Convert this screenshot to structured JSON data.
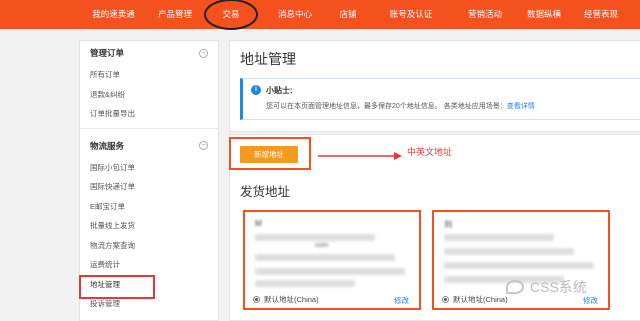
{
  "topnav": {
    "items": [
      "我的速卖通",
      "产品管理",
      "交易",
      "消息中心",
      "店铺",
      "账号及认证",
      "营销活动",
      "数据纵横",
      "经营表现"
    ],
    "active_index": 2
  },
  "sidebar": {
    "groups": [
      {
        "title": "管理订单",
        "toggle": "−",
        "items": [
          "所有订单",
          "退款&纠纷",
          "订单批量导出"
        ]
      },
      {
        "title": "物流服务",
        "toggle": "−",
        "items": [
          "国际小包订单",
          "国际快递订单",
          "E邮宝订单",
          "批量线上发货",
          "物流方案查询",
          "运费统计",
          "地址管理",
          "投诉管理"
        ]
      }
    ],
    "current_item": "地址管理"
  },
  "main": {
    "title": "地址管理",
    "tip": {
      "icon": "info-icon",
      "title": "小贴士:",
      "text": "您可以在本页面管理地址信息，最多保存20个地址信息。 各类地址应用场景：",
      "link": "查看详情"
    },
    "add_button": "新增地址",
    "annotation": "中英文地址",
    "section_title": "发货地址",
    "cards": [
      {
        "name": "M",
        "line_text": "com",
        "default_label": "默认地址(China)",
        "edit_label": "修改"
      },
      {
        "name": "刘",
        "line_text": "",
        "default_label": "默认地址(China)",
        "edit_label": "修改"
      }
    ]
  },
  "watermark": {
    "text": "CSS系统"
  },
  "colors": {
    "brand": "#f4511e",
    "highlight": "#e53935",
    "link": "#1e88e5",
    "button": "#f49a1e"
  }
}
